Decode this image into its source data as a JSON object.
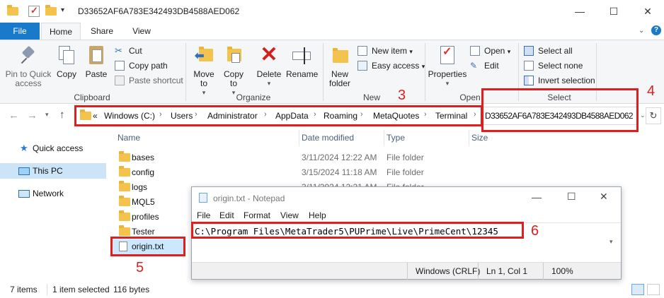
{
  "window": {
    "title": "D33652AF6A783E342493DB4588AED062",
    "minimize": "—",
    "maximize": "☐",
    "close": "✕"
  },
  "ribbon_tabs": [
    "File",
    "Home",
    "Share",
    "View"
  ],
  "clipboard": {
    "pin": "Pin to Quick access",
    "copy": "Copy",
    "paste": "Paste",
    "cut": "Cut",
    "copy_path": "Copy path",
    "paste_shortcut": "Paste shortcut",
    "label": "Clipboard"
  },
  "organize": {
    "move_to": "Move to",
    "copy_to": "Copy to",
    "delete": "Delete",
    "rename": "Rename",
    "label": "Organize"
  },
  "new_group": {
    "new_folder": "New folder",
    "new_item": "New item",
    "easy_access": "Easy access",
    "label": "New"
  },
  "open_group": {
    "properties": "Properties",
    "open": "Open",
    "edit": "Edit",
    "label": "Open"
  },
  "select_group": {
    "select_all": "Select all",
    "select_none": "Select none",
    "invert": "Invert selection",
    "label": "Select"
  },
  "address": {
    "overflow": "«",
    "crumbs": [
      "Windows (C:)",
      "Users",
      "Administrator",
      "AppData",
      "Roaming",
      "MetaQuotes",
      "Terminal",
      "D33652AF6A783E342493DB4588AED062"
    ]
  },
  "nav_pane": {
    "quick_access": "Quick access",
    "this_pc": "This PC",
    "network": "Network"
  },
  "columns": {
    "name": "Name",
    "date": "Date modified",
    "type": "Type",
    "size": "Size"
  },
  "files": [
    {
      "name": "bases",
      "date": "3/11/2024 12:22 AM",
      "type": "File folder"
    },
    {
      "name": "config",
      "date": "3/15/2024 11:18 AM",
      "type": "File folder"
    },
    {
      "name": "logs",
      "date": "3/11/2024 12:21 AM",
      "type": "File folder"
    },
    {
      "name": "MQL5",
      "date": "",
      "type": ""
    },
    {
      "name": "profiles",
      "date": "",
      "type": ""
    },
    {
      "name": "Tester",
      "date": "",
      "type": ""
    },
    {
      "name": "origin.txt",
      "date": "",
      "type": ""
    }
  ],
  "status": {
    "items": "7 items",
    "selected": "1 item selected",
    "size": "116 bytes"
  },
  "notepad": {
    "title": "origin.txt - Notepad",
    "menu": [
      "File",
      "Edit",
      "Format",
      "View",
      "Help"
    ],
    "content": "C:\\Program Files\\MetaTrader5\\PUPrime\\Live\\PrimeCent\\12345",
    "encoding": "Windows (CRLF)",
    "position": "Ln 1, Col 1",
    "zoom": "100%"
  },
  "annotations": {
    "n3": "3",
    "n4": "4",
    "n5": "5",
    "n6": "6"
  },
  "colors": {
    "accent": "#1979ca",
    "annotation": "#e21d1d",
    "folder": "#f3c34d"
  }
}
